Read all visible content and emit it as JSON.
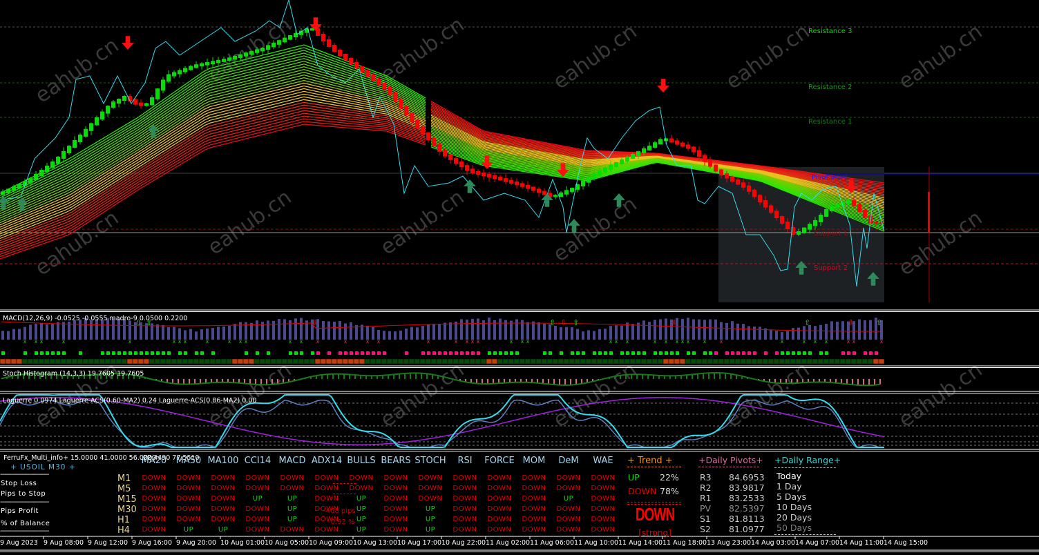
{
  "symbol_timeframe": "+ USOIL M30 +",
  "watermark": "eahub.cn",
  "levels": {
    "resistance3": "Resistance 3",
    "resistance2": "Resistance 2",
    "resistance1": "Resistance 1",
    "pivot": "Pivot level",
    "support1": "Support 1",
    "support2": "Support 2"
  },
  "subwindows": {
    "macd": "MACD(12,26,9) -0.0525 -0.0555  madro-9 0.0500 0.2200",
    "stoch": "Stoch Histogram (14,3,3) 19.7605 19.7605",
    "laguerre": "Laguerre 0.0974  Laguerre-ACS(0.60-MA2) 0.24  Laguerre-ACS(0.86-MA2) 0.00"
  },
  "info_panel": {
    "title": "FerruFx_Multi_info+ 15.0000 41.0000 56.0000",
    "extra_values": "22.4490 77.5510",
    "symbol": "+ USOIL M30 +",
    "separator": "---------------------------",
    "stop_loss": "Stop Loss",
    "pips_to_stop": "Pips to Stop",
    "pips_profit": "Pips Profit",
    "percent_balance": "% of Balance",
    "pips_value": "-468 pips",
    "percent_value": "-0.92 %",
    "columns": [
      "MA20",
      "MA50",
      "MA100",
      "CCI14",
      "MACD",
      "ADX14",
      "BULLS",
      "BEARS",
      "STOCH",
      "RSI",
      "FORCE",
      "MOM",
      "DeM",
      "WAE"
    ],
    "rows": [
      {
        "tf": "M1",
        "values": [
          "DOWN",
          "DOWN",
          "DOWN",
          "DOWN",
          "DOWN",
          "DOWN",
          "DOWN",
          "DOWN",
          "DOWN",
          "DOWN",
          "DOWN",
          "DOWN",
          "DOWN",
          "DOWN"
        ]
      },
      {
        "tf": "M5",
        "values": [
          "DOWN",
          "DOWN",
          "DOWN",
          "DOWN",
          "DOWN",
          "DOWN",
          "DOWN",
          "DOWN",
          "DOWN",
          "DOWN",
          "DOWN",
          "DOWN",
          "DOWN",
          "DOWN"
        ]
      },
      {
        "tf": "M15",
        "values": [
          "DOWN",
          "DOWN",
          "DOWN",
          "UP",
          "UP",
          "DOWN",
          "UP",
          "DOWN",
          "DOWN",
          "DOWN",
          "DOWN",
          "DOWN",
          "UP",
          "DOWN"
        ]
      },
      {
        "tf": "M30",
        "values": [
          "DOWN",
          "DOWN",
          "DOWN",
          "DOWN",
          "UP",
          "DOWN",
          "UP",
          "DOWN",
          "UP",
          "DOWN",
          "DOWN",
          "DOWN",
          "DOWN",
          "DOWN"
        ]
      },
      {
        "tf": "H1",
        "values": [
          "DOWN",
          "DOWN",
          "DOWN",
          "DOWN",
          "UP",
          "DOWN",
          "UP",
          "DOWN",
          "UP",
          "DOWN",
          "DOWN",
          "DOWN",
          "DOWN",
          "DOWN"
        ]
      },
      {
        "tf": "H4",
        "values": [
          "DOWN",
          "UP",
          "UP",
          "DOWN",
          "DOWN",
          "DOWN",
          "UP",
          "DOWN",
          "UP",
          "DOWN",
          "DOWN",
          "DOWN",
          "DOWN",
          "DOWN"
        ]
      }
    ],
    "trend": {
      "title": "+  Trend  +",
      "up_label": "UP",
      "up_value": "22%",
      "down_label": "DOWN",
      "down_value": "78%",
      "signal": "DOWN",
      "strength": "[strong]"
    },
    "pivots": {
      "title": "+Daily Pivots+",
      "rows": [
        {
          "label": "R3",
          "value": "84.6953"
        },
        {
          "label": "R2",
          "value": "83.9817"
        },
        {
          "label": "R1",
          "value": "83.2533"
        },
        {
          "label": "PV",
          "value": "82.5397"
        },
        {
          "label": "S1",
          "value": "81.8113"
        },
        {
          "label": "S2",
          "value": "81.0977"
        }
      ]
    },
    "range": {
      "title": "+Daily Range+",
      "items": [
        "Today",
        "1 Day",
        "5 Days",
        "10 Days",
        "20 Days",
        "50 Days"
      ]
    }
  },
  "colors": {
    "up": "#00e000",
    "down": "#e00000",
    "macd_hist": "#4b4a8e",
    "cyan": "#33ddee",
    "pivot_line": "#0000cc"
  },
  "time_axis": [
    "9 Aug 2023",
    "9 Aug 08:00",
    "9 Aug 12:00",
    "9 Aug 16:00",
    "9 Aug 20:00",
    "10 Aug 01:00",
    "10 Aug 05:00",
    "10 Aug 09:00",
    "10 Aug 13:00",
    "10 Aug 17:00",
    "10 Aug 22:00",
    "11 Aug 02:00",
    "11 Aug 06:00",
    "11 Aug 10:00",
    "11 Aug 14:00",
    "11 Aug 18:00",
    "13 Aug 23:00",
    "14 Aug 03:00",
    "14 Aug 07:00",
    "14 Aug 11:00",
    "14 Aug 15:00"
  ]
}
